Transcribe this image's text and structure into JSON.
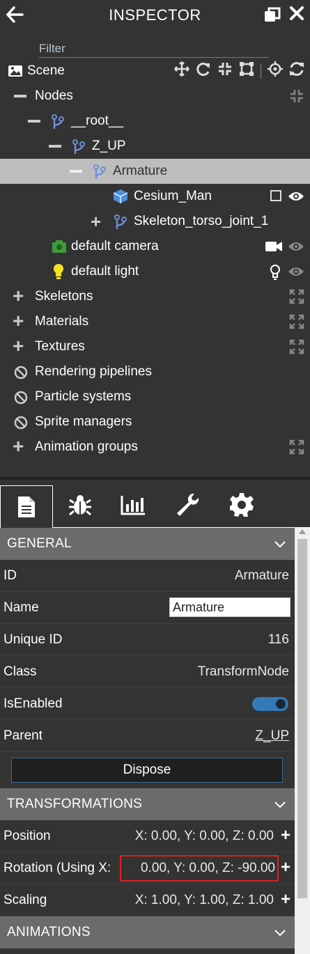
{
  "header": {
    "title": "INSPECTOR"
  },
  "filter": {
    "placeholder": "Filter"
  },
  "scene": {
    "label": "Scene"
  },
  "tree": {
    "nodes_label": "Nodes",
    "root": "__root__",
    "z_up": "Z_UP",
    "armature": "Armature",
    "cesium_man": "Cesium_Man",
    "skeleton_joint": "Skeleton_torso_joint_1",
    "camera": "default camera",
    "light": "default light",
    "skeletons": "Skeletons",
    "materials": "Materials",
    "textures": "Textures",
    "rendering_pipelines": "Rendering pipelines",
    "particle_systems": "Particle systems",
    "sprite_managers": "Sprite managers",
    "animation_groups": "Animation groups"
  },
  "general": {
    "title": "GENERAL",
    "id_label": "ID",
    "id_value": "Armature",
    "name_label": "Name",
    "name_value": "Armature",
    "uid_label": "Unique ID",
    "uid_value": "116",
    "class_label": "Class",
    "class_value": "TransformNode",
    "enabled_label": "IsEnabled",
    "enabled": true,
    "parent_label": "Parent",
    "parent_value": "Z_UP",
    "dispose_label": "Dispose"
  },
  "transformations": {
    "title": "TRANSFORMATIONS",
    "position_label": "Position",
    "position_value": "X: 0.00, Y: 0.00, Z: 0.00",
    "rotation_label": "Rotation (Using X:",
    "rotation_value": "0.00, Y: 0.00, Z: -90.00",
    "scaling_label": "Scaling",
    "scaling_value": "X: 1.00, Y: 1.00, Z: 1.00"
  },
  "animations": {
    "title": "ANIMATIONS"
  },
  "colors": {
    "accent": "#337ab7",
    "selected_row": "#bdbdbd",
    "node_icon": "#6f8fd9",
    "highlight": "#e02020"
  }
}
